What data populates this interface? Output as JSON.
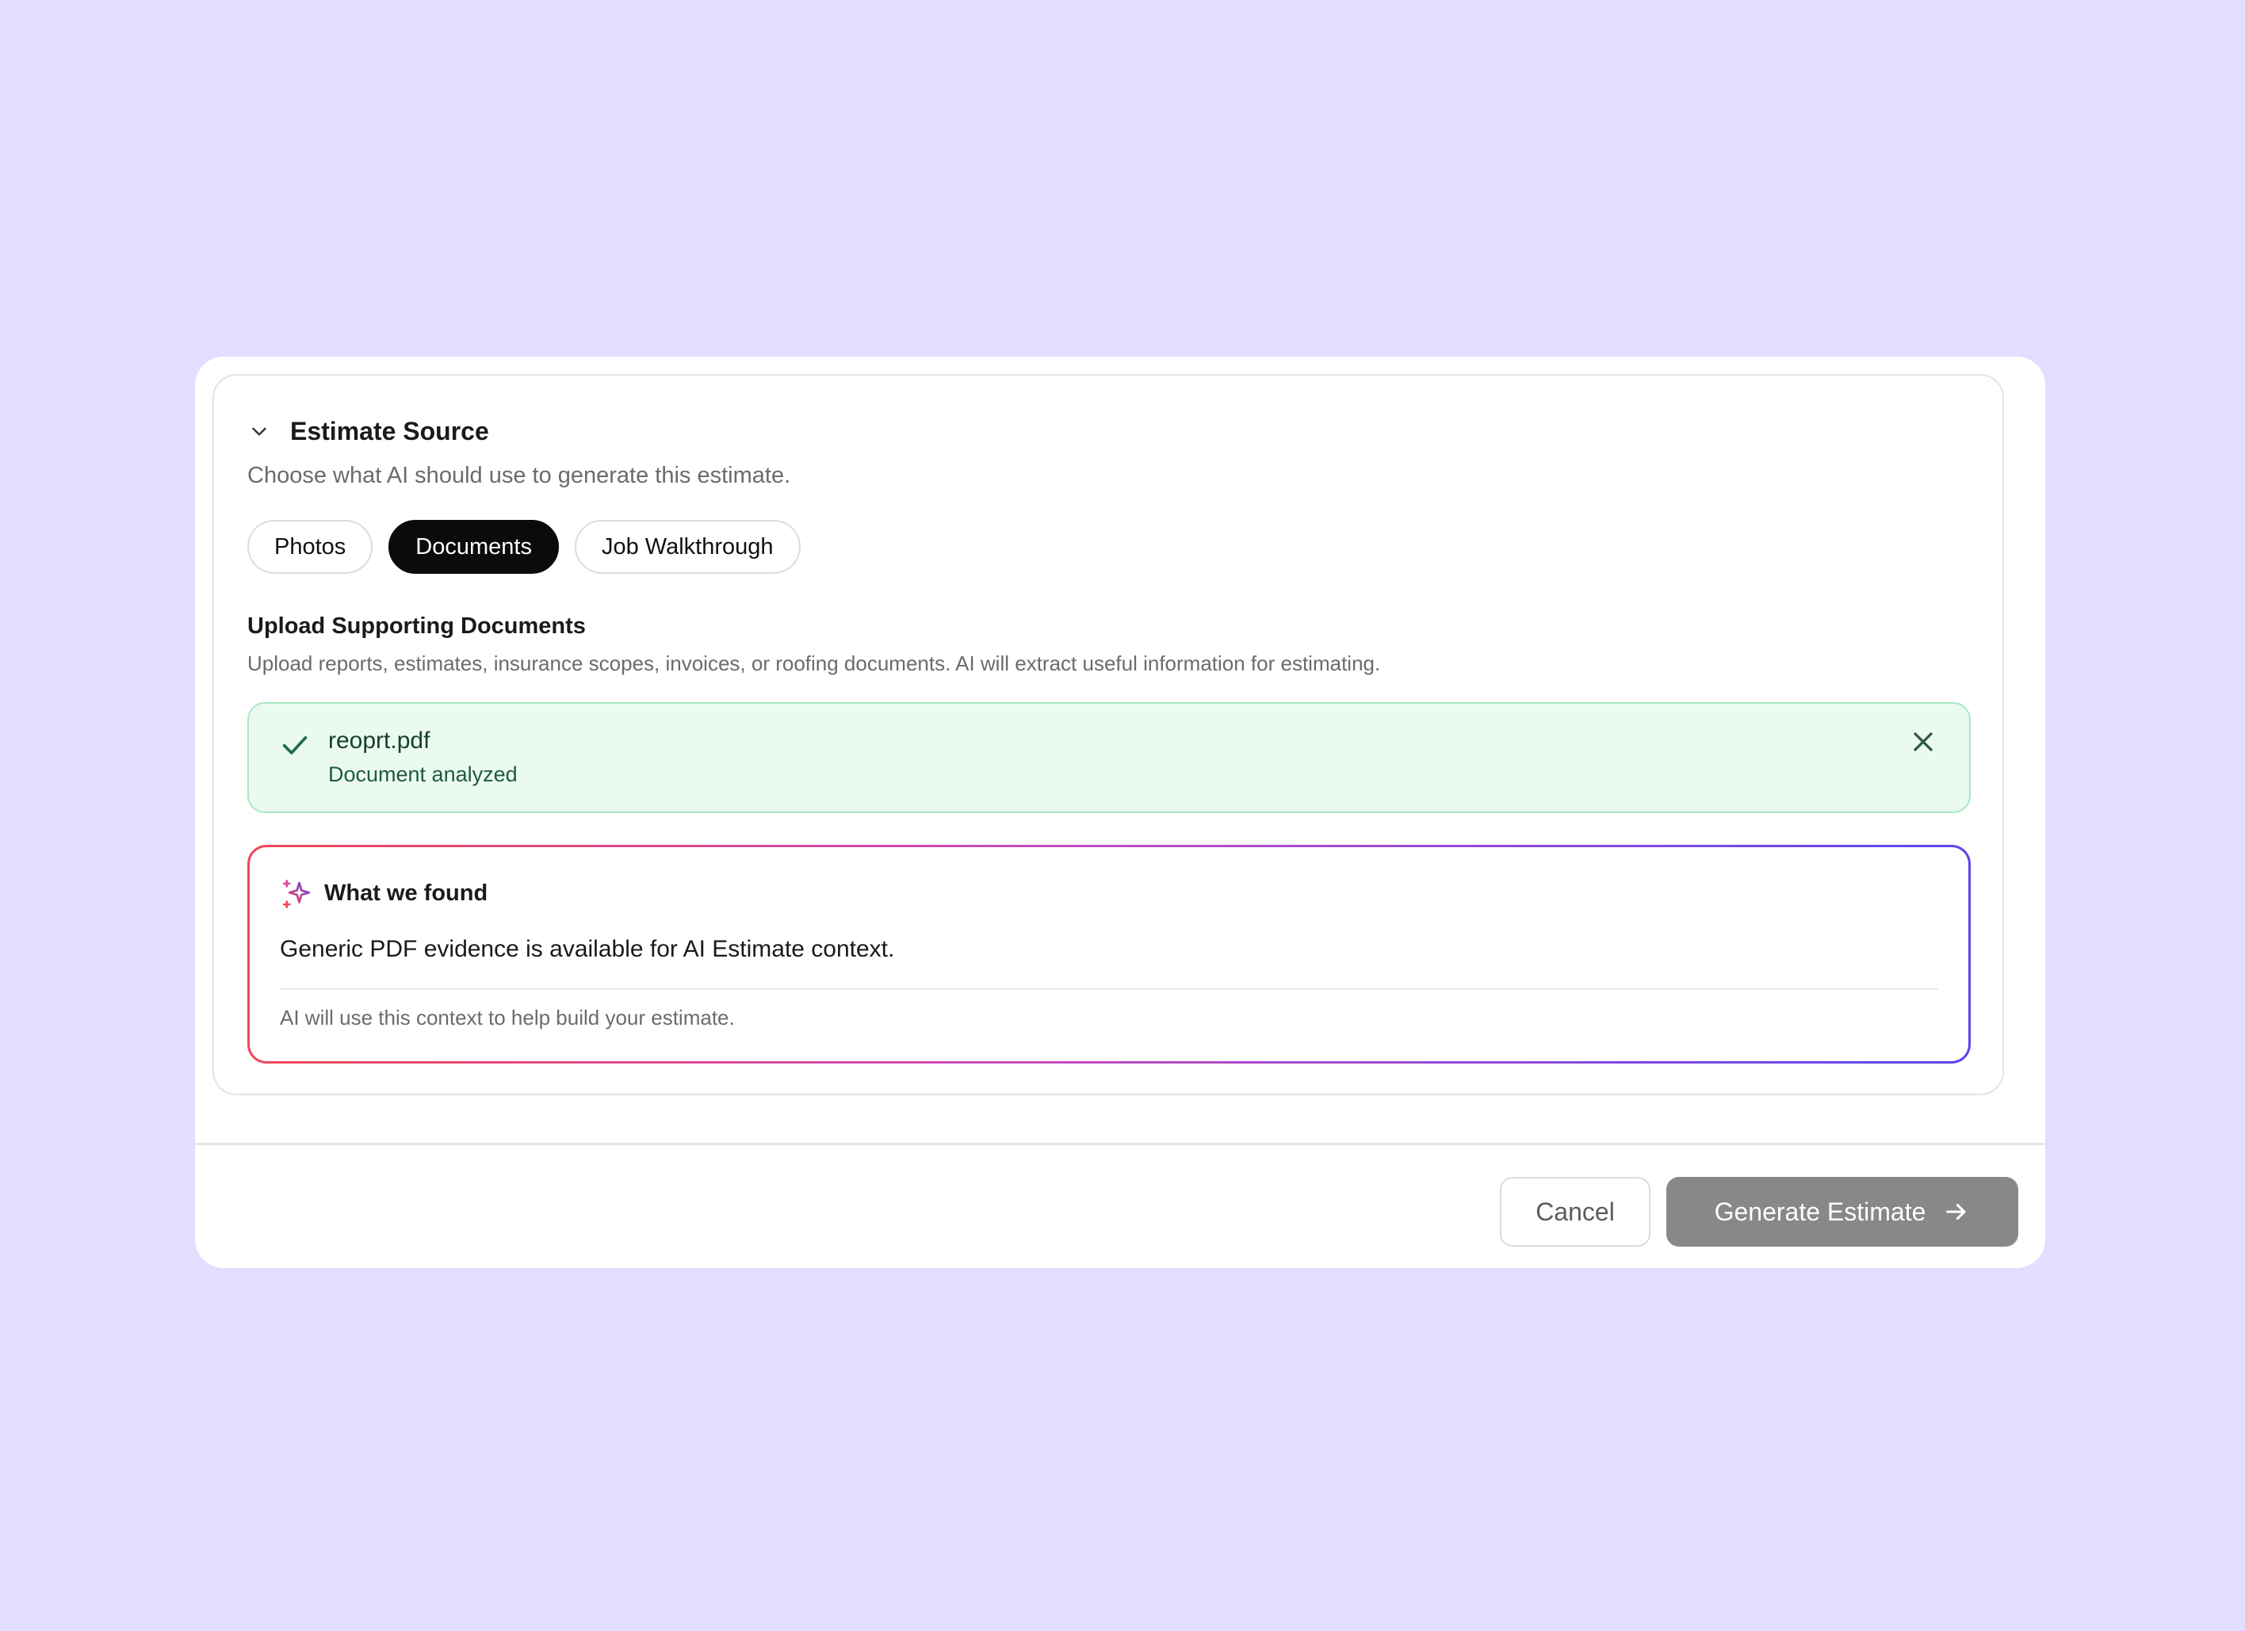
{
  "section": {
    "title": "Estimate Source",
    "subtitle": "Choose what AI should use to generate this estimate."
  },
  "tabs": [
    {
      "label": "Photos",
      "active": false
    },
    {
      "label": "Documents",
      "active": true
    },
    {
      "label": "Job Walkthrough",
      "active": false
    }
  ],
  "upload": {
    "title": "Upload Supporting Documents",
    "description": "Upload reports, estimates, insurance scopes, invoices, or roofing documents. AI will extract useful information for estimating."
  },
  "file": {
    "name": "reoprt.pdf",
    "status": "Document analyzed",
    "icon": "check-icon"
  },
  "found": {
    "title": "What we found",
    "text": "Generic PDF evidence is available for AI Estimate context.",
    "note": "AI will use this context to help build your estimate.",
    "icon": "sparkle-icon"
  },
  "footer": {
    "cancel_label": "Cancel",
    "generate_label": "Generate Estimate"
  },
  "colors": {
    "background": "#e2deff",
    "success_bg": "#ebfaf1",
    "success_border": "#a7e8c4",
    "gradient_start": "#f04858",
    "gradient_end": "#5b46f0",
    "primary_disabled": "#888888"
  }
}
